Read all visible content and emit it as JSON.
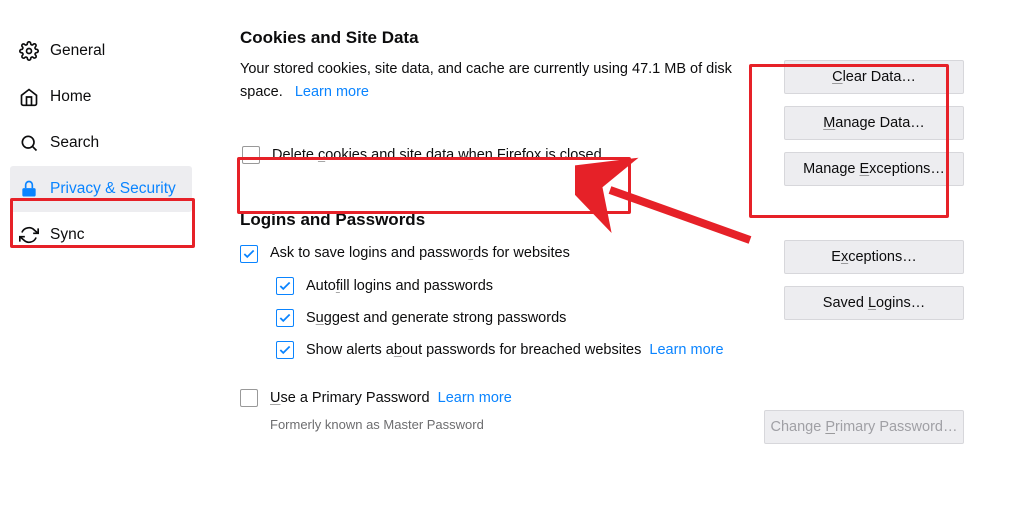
{
  "sidebar": {
    "items": [
      {
        "label": "General"
      },
      {
        "label": "Home"
      },
      {
        "label": "Search"
      },
      {
        "label": "Privacy & Security"
      },
      {
        "label": "Sync"
      }
    ]
  },
  "cookies": {
    "heading": "Cookies and Site Data",
    "desc_prefix": "Your stored cookies, site data, and cache are currently using ",
    "usage": "47.1 MB",
    "desc_suffix": " of disk space.",
    "learn_more": "Learn more",
    "delete_label_pre": "Delete ",
    "delete_label_u": "c",
    "delete_label_post": "ookies and site data when Firefox is closed",
    "btn_clear_pre": "",
    "btn_clear_u": "C",
    "btn_clear_post": "lear Data…",
    "btn_manage_pre": "",
    "btn_manage_u": "M",
    "btn_manage_post": "anage Data…",
    "btn_exc_pre": "Manage ",
    "btn_exc_u": "E",
    "btn_exc_post": "xceptions…"
  },
  "logins": {
    "heading": "Logins and Passwords",
    "ask_pre": "Ask to save logins and passwo",
    "ask_u": "r",
    "ask_post": "ds for websites",
    "autofill_pre": "Auto",
    "autofill_u": "f",
    "autofill_post": "ill logins and passwords",
    "suggest_pre": "S",
    "suggest_u": "u",
    "suggest_post": "ggest and generate strong passwords",
    "alerts_pre": "Show alerts a",
    "alerts_u": "b",
    "alerts_post": "out passwords for breached websites",
    "learn_more": "Learn more",
    "primary_pre": "",
    "primary_u": "U",
    "primary_post": "se a Primary Password",
    "primary_learn": "Learn more",
    "primary_hint": "Formerly known as Master Password",
    "btn_exc_pre": "E",
    "btn_exc_u": "x",
    "btn_exc_post": "ceptions…",
    "btn_saved_pre": "Saved ",
    "btn_saved_u": "L",
    "btn_saved_post": "ogins…",
    "btn_change_pre": "Change ",
    "btn_change_u": "P",
    "btn_change_post": "rimary Password…"
  }
}
